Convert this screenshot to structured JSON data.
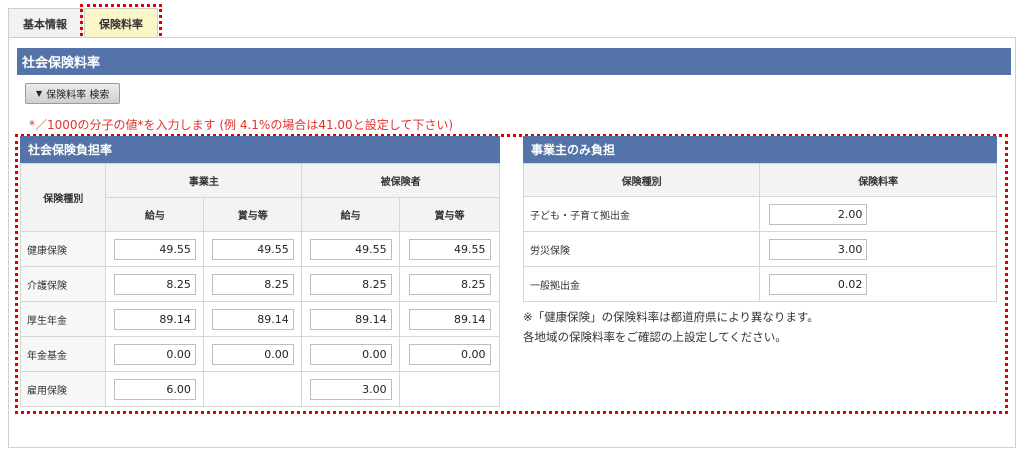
{
  "tabs": [
    {
      "label": "基本情報",
      "active": false
    },
    {
      "label": "保険料率",
      "active": true
    }
  ],
  "section_title": "社会保険料率",
  "search_button_label": "保険料率 検索",
  "input_note": "*／1000の分子の値*を入力します (例 4.1%の場合は41.00と設定して下さい)",
  "burden": {
    "title": "社会保険負担率",
    "type_header": "保険種別",
    "employer_header": "事業主",
    "insured_header": "被保険者",
    "salary_header": "給与",
    "bonus_header": "賞与等",
    "rows": [
      {
        "label": "健康保険",
        "employer_salary": "49.55",
        "employer_bonus": "49.55",
        "insured_salary": "49.55",
        "insured_bonus": "49.55"
      },
      {
        "label": "介護保険",
        "employer_salary": "8.25",
        "employer_bonus": "8.25",
        "insured_salary": "8.25",
        "insured_bonus": "8.25"
      },
      {
        "label": "厚生年金",
        "employer_salary": "89.14",
        "employer_bonus": "89.14",
        "insured_salary": "89.14",
        "insured_bonus": "89.14"
      },
      {
        "label": "年金基金",
        "employer_salary": "0.00",
        "employer_bonus": "0.00",
        "insured_salary": "0.00",
        "insured_bonus": "0.00"
      }
    ],
    "employment": {
      "label": "雇用保険",
      "employer": "6.00",
      "insured": "3.00"
    }
  },
  "employer_only": {
    "title": "事業主のみ負担",
    "type_header": "保険種別",
    "rate_header": "保険料率",
    "rows": [
      {
        "label": "子ども・子育て拠出金",
        "value": "2.00"
      },
      {
        "label": "労災保険",
        "value": "3.00"
      },
      {
        "label": "一般拠出金",
        "value": "0.02"
      }
    ]
  },
  "caution_lines": [
    "※「健康保険」の保険料率は都道府県により異なります。",
    "各地域の保険料率をご確認の上設定してください。"
  ],
  "colors": {
    "header_blue": "#5373a9",
    "highlight_red": "#e00000",
    "note_red": "#e0352b",
    "active_tab": "#fbf6c8"
  }
}
